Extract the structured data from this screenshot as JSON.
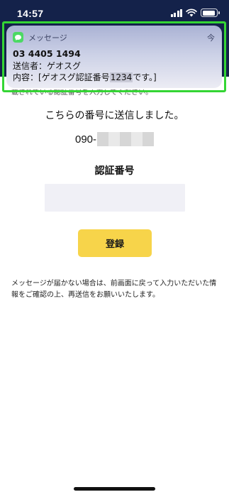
{
  "status_bar": {
    "time": "14:57",
    "icons": [
      "signal-icon",
      "wifi-icon",
      "battery-icon"
    ]
  },
  "notification": {
    "app_icon": "messages-icon",
    "app_name": "メッセージ",
    "time": "今",
    "sender_number": "03 4405 1494",
    "line1": "送信者：ゲオスグ",
    "line2_prefix": "内容：[ゲオスグ認証番号",
    "line2_code": "1234",
    "line2_suffix": "です。]"
  },
  "page": {
    "header_color": "#14224a",
    "obscured_text": "載されている認証番号を入力してください。",
    "sent_message": "こちらの番号に送信しました。",
    "phone_prefix": "090-",
    "code_label": "認証番号",
    "code_input": {
      "value": "",
      "placeholder": ""
    },
    "register_button": "登録",
    "help_text": "メッセージが届かない場合は、前画面に戻って入力いただいた情報をご確認の上、再送信をお願いいたします。"
  },
  "colors": {
    "highlight_border": "#34d534",
    "button": "#f7d44a",
    "input_background": "#f0f0f6",
    "messages_icon": "#4cd964"
  }
}
